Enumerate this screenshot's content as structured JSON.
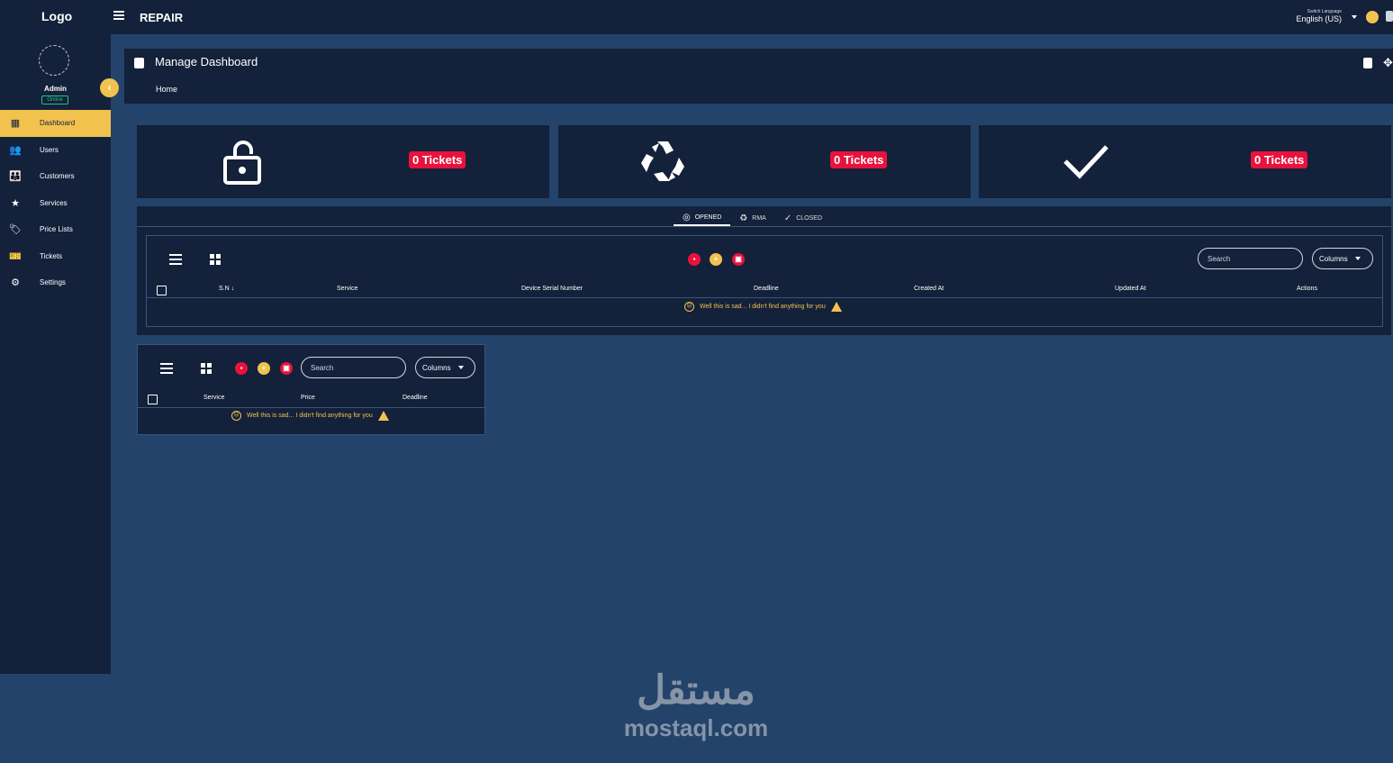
{
  "topbar": {
    "logo": "Logo",
    "app_title": "REPAIR",
    "language_label": "Switch Language",
    "language_value": "English (US)"
  },
  "sidebar": {
    "user_name": "Admin",
    "user_status": "Online",
    "items": [
      {
        "label": "Dashboard",
        "icon": "dashboard-icon",
        "active": true
      },
      {
        "label": "Users",
        "icon": "users-icon",
        "active": false
      },
      {
        "label": "Customers",
        "icon": "customers-icon",
        "active": false
      },
      {
        "label": "Services",
        "icon": "star-icon",
        "active": false
      },
      {
        "label": "Price Lists",
        "icon": "tag-icon",
        "active": false
      },
      {
        "label": "Tickets",
        "icon": "ticket-icon",
        "active": false
      },
      {
        "label": "Settings",
        "icon": "gear-icon",
        "active": false
      }
    ]
  },
  "header": {
    "title": "Manage Dashboard",
    "breadcrumb": "Home"
  },
  "stats": [
    {
      "icon": "lock-open-icon",
      "badge": "0 Tickets"
    },
    {
      "icon": "recycle-icon",
      "badge": "0 Tickets"
    },
    {
      "icon": "check-icon",
      "badge": "0 Tickets"
    }
  ],
  "tabs": [
    {
      "label": "OPENED",
      "icon": "opened-icon",
      "active": true
    },
    {
      "label": "RMA",
      "icon": "recycle-icon",
      "active": false
    },
    {
      "label": "CLOSED",
      "icon": "check-icon",
      "active": false
    }
  ],
  "tickets_table": {
    "search_placeholder": "Search",
    "columns_label": "Columns",
    "headers": [
      "S.N ↓",
      "Service",
      "Device Serial Number",
      "Deadline",
      "Created At",
      "Updated At",
      "Actions"
    ],
    "empty_message": "Well this is sad... I didn't find anything for you"
  },
  "services_table": {
    "search_placeholder": "Search",
    "columns_label": "Columns",
    "headers": [
      "Service",
      "Price",
      "Deadline"
    ],
    "empty_message": "Well this is sad... I didn't find anything for you"
  },
  "watermark": {
    "arabic": "مستقل",
    "latin": "mostaql.com"
  },
  "colors": {
    "accent": "#f2c24f",
    "danger": "#e8123d",
    "panel": "#13213a",
    "background": "#23436a"
  }
}
